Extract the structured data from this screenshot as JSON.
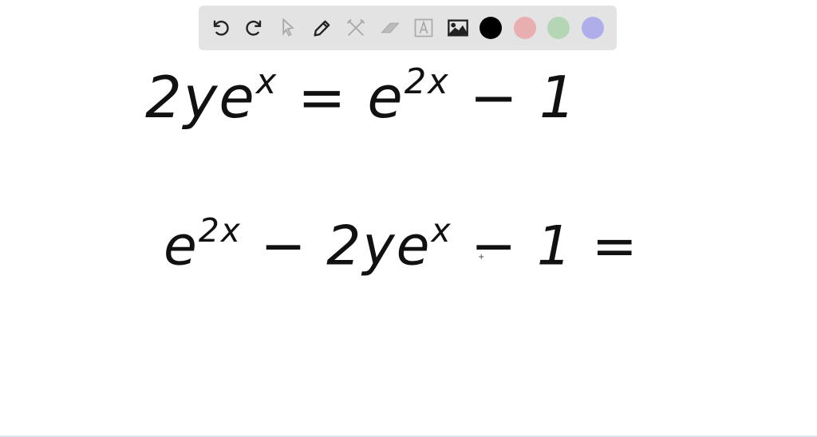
{
  "toolbar": {
    "tools": [
      "undo-icon",
      "redo-icon",
      "select-icon",
      "pen-icon",
      "tools-icon",
      "eraser-icon",
      "text-icon",
      "image-icon"
    ],
    "colors": {
      "black": "#000000",
      "red": "#e8aeb0",
      "green": "#b5d6b5",
      "blue": "#b0aeea"
    }
  },
  "canvas": {
    "eq1": {
      "a": "2ye",
      "a_sup": "x",
      "b": " = e",
      "b_sup": "2x",
      "c": " − 1"
    },
    "eq2": {
      "a": "e",
      "a_sup": "2x",
      "b": " − 2ye",
      "b_sup": "x",
      "c": " − 1 ="
    },
    "cursor": "+"
  }
}
